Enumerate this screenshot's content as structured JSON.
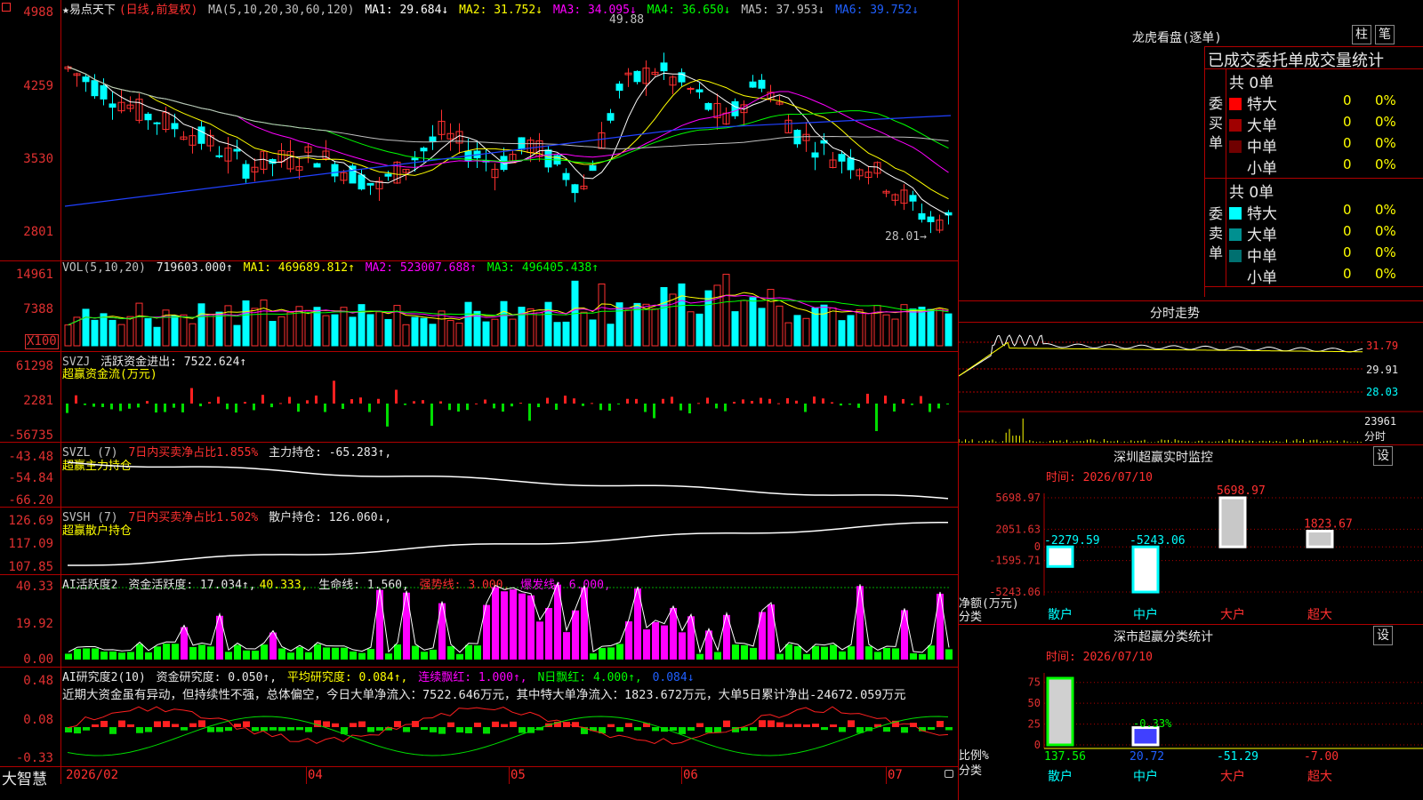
{
  "app": {
    "logo": "大智慧",
    "stock": "★易点天下",
    "mode": "(日线,前复权)"
  },
  "colors": {
    "up": "#ff3030",
    "down": "#00ffff",
    "bg": "#000000",
    "grid": "#b00000"
  },
  "kline": {
    "ma_label": "MA(5,10,20,30,60,120)",
    "ma": [
      {
        "label": "MA1: 29.684↓",
        "color": "#ffffff"
      },
      {
        "label": "MA2: 31.752↓",
        "color": "#ffff00"
      },
      {
        "label": "MA3: 34.095↓",
        "color": "#ff00ff"
      },
      {
        "label": "MA4: 36.650↓",
        "color": "#00ff00"
      },
      {
        "label": "MA5: 37.953↓",
        "color": "#c0c0c0"
      },
      {
        "label": "MA6: 39.752↓",
        "color": "#2060ff"
      }
    ],
    "y_ticks": [
      "4988",
      "4259",
      "3530",
      "2801"
    ],
    "high_label": "49.88",
    "low_label": "28.01→"
  },
  "vol": {
    "name": "VOL(5,10,20)",
    "value": "719603.000↑",
    "ma1": "MA1: 469689.812↑",
    "ma2": "MA2: 523007.688↑",
    "ma3": "MA3: 496405.438↑",
    "y_ticks": [
      "14961",
      "7388"
    ],
    "unit": "X100"
  },
  "svzj": {
    "name": "SVZJ",
    "desc": "活跃资金进出: 7522.624↑",
    "sub": "超赢资金流(万元)",
    "y_ticks": [
      "61298",
      "2281",
      "-56735"
    ]
  },
  "svzl": {
    "name": "SVZL (7)",
    "desc1": "7日内买卖净占比1.855%",
    "desc2": "主力持仓: -65.283↑,",
    "sub": "超赢主力持仓",
    "y_ticks": [
      "-43.48",
      "-54.84",
      "-66.20"
    ]
  },
  "svsh": {
    "name": "SVSH (7)",
    "desc1": "7日内买卖净占比1.502%",
    "desc2": "散户持仓: 126.060↓,",
    "sub": "超赢散户持仓",
    "y_ticks": [
      "126.69",
      "117.09",
      "107.85"
    ]
  },
  "ai_act": {
    "name": "AI活跃度2",
    "d1": "资金活跃度: 17.034↑,",
    "d2": "40.333,",
    "d3": "生命线: 1.560,",
    "d4": "强势线: 3.000,",
    "d5": "爆发线: 6.000,",
    "y_ticks": [
      "40.33",
      "19.92",
      "0.00"
    ]
  },
  "ai_res": {
    "name": "AI研究度2(10)",
    "d1": "资金研究度: 0.050↑,",
    "d2": "平均研究度: 0.084↑,",
    "d3": "连续飘红: 1.000↑,",
    "d4": "N日飘红: 4.000↑,",
    "d5": "0.084↓",
    "comment": "近期大资金虽有异动，但持续性不强，总体偏空，今日大单净流入：7522.646万元，其中特大单净流入：1823.672万元，大单5日累计净出-24672.059万元",
    "y_ticks": [
      "0.48",
      "0.08",
      "-0.33"
    ]
  },
  "x_axis": [
    "2026/02",
    "04",
    "05",
    "06",
    "07"
  ],
  "longhu": {
    "title": "龙虎看盘(逐单)",
    "btn1": "柱",
    "btn2": "笔",
    "header": "已成交委托单成交量统计",
    "buy": {
      "label": "委买单",
      "total": "共 0单",
      "rows": [
        {
          "name": "特大",
          "val": "0",
          "pct": "0%",
          "color": "#ff0000"
        },
        {
          "name": "大单",
          "val": "0",
          "pct": "0%",
          "color": "#a00000"
        },
        {
          "name": "中单",
          "val": "0",
          "pct": "0%",
          "color": "#700000"
        },
        {
          "name": "小单",
          "val": "0",
          "pct": "0%",
          "color": "#000000"
        }
      ]
    },
    "sell": {
      "label": "委卖单",
      "total": "共 0单",
      "rows": [
        {
          "name": "特大",
          "val": "0",
          "pct": "0%",
          "color": "#00ffff"
        },
        {
          "name": "大单",
          "val": "0",
          "pct": "0%",
          "color": "#009090"
        },
        {
          "name": "中单",
          "val": "0",
          "pct": "0%",
          "color": "#007070"
        },
        {
          "name": "小单",
          "val": "0",
          "pct": "0%",
          "color": "#000000"
        }
      ]
    }
  },
  "intraday": {
    "title": "分时走势",
    "prices": [
      "31.79",
      "29.91",
      "28.03"
    ],
    "vol": "23961",
    "vol_label": "分时"
  },
  "monitor": {
    "title": "深圳超赢实时监控",
    "set": "设",
    "time": "时间: 2026/07/10",
    "y_ticks": [
      "5698.97",
      "2051.63",
      "0",
      "-1595.71",
      "-5243.06"
    ],
    "ylabel": "净额(万元)",
    "xlabel": "分类",
    "categories": [
      "散户",
      "中户",
      "大户",
      "超大"
    ],
    "values": [
      -2279.59,
      -5243.06,
      5698.97,
      1823.67
    ],
    "value_labels": [
      "-2279.59",
      "-5243.06",
      "5698.97",
      "1823.67"
    ]
  },
  "classify": {
    "title": "深市超赢分类统计",
    "set": "设",
    "time": "时间: 2026/07/10",
    "y_ticks": [
      "75",
      "50",
      "25",
      "0"
    ],
    "ylabel": "比例%",
    "xlabel": "分类",
    "categories": [
      "散户",
      "中户",
      "大户",
      "超大"
    ],
    "values": [
      137.56,
      20.72,
      -51.29,
      -7.0
    ],
    "value_labels": [
      "137.56",
      "20.72",
      "-51.29",
      "-7.00"
    ],
    "extra_label": "-0.33%"
  }
}
